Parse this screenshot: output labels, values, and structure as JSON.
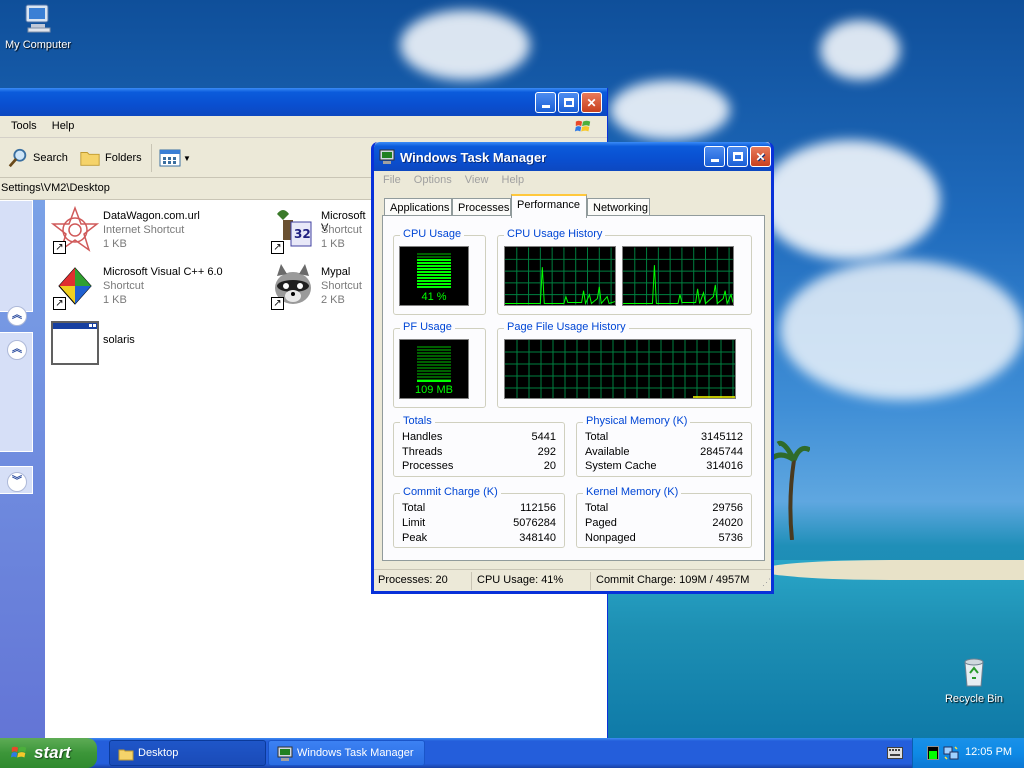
{
  "desktop": {
    "icons": [
      {
        "label": "My Computer",
        "icon": "my-computer-icon"
      },
      {
        "label": "Recycle Bin",
        "icon": "recycle-bin-icon"
      }
    ]
  },
  "explorer": {
    "menu": [
      "Tools",
      "Help"
    ],
    "toolbar": {
      "search": "Search",
      "folders": "Folders"
    },
    "address": "Settings\\VM2\\Desktop",
    "files": [
      {
        "name": "DataWagon.com.url",
        "type": "Internet Shortcut",
        "size": "1 KB",
        "icon": "datawagon-icon",
        "shortcut": true
      },
      {
        "name": "Microsoft V",
        "type": "Shortcut",
        "size": "1 KB",
        "icon": "microsoft-vm-icon",
        "shortcut": true
      },
      {
        "name": "Microsoft Visual C++ 6.0",
        "type": "Shortcut",
        "size": "1 KB",
        "icon": "visual-cpp-icon",
        "shortcut": true
      },
      {
        "name": "Mypal",
        "type": "Shortcut",
        "size": "2 KB",
        "icon": "mypal-raccoon-icon",
        "shortcut": true
      },
      {
        "name": "solaris",
        "type": "",
        "size": "",
        "icon": "window-icon",
        "shortcut": false
      }
    ]
  },
  "taskmanager": {
    "title": "Windows Task Manager",
    "menu": [
      "File",
      "Options",
      "View",
      "Help"
    ],
    "tabs": [
      "Applications",
      "Processes",
      "Performance",
      "Networking"
    ],
    "active_tab": "Performance",
    "cpu_usage": {
      "label": "CPU Usage",
      "value": "41 %"
    },
    "cpu_history": {
      "label": "CPU Usage History"
    },
    "pf_usage": {
      "label": "PF Usage",
      "value": "109 MB"
    },
    "pf_history": {
      "label": "Page File Usage History"
    },
    "totals": {
      "label": "Totals",
      "rows": [
        {
          "k": "Handles",
          "v": "5441"
        },
        {
          "k": "Threads",
          "v": "292"
        },
        {
          "k": "Processes",
          "v": "20"
        }
      ]
    },
    "physical": {
      "label": "Physical Memory (K)",
      "rows": [
        {
          "k": "Total",
          "v": "3145112"
        },
        {
          "k": "Available",
          "v": "2845744"
        },
        {
          "k": "System Cache",
          "v": "314016"
        }
      ]
    },
    "commit": {
      "label": "Commit Charge (K)",
      "rows": [
        {
          "k": "Total",
          "v": "112156"
        },
        {
          "k": "Limit",
          "v": "5076284"
        },
        {
          "k": "Peak",
          "v": "348140"
        }
      ]
    },
    "kernel": {
      "label": "Kernel Memory (K)",
      "rows": [
        {
          "k": "Total",
          "v": "29756"
        },
        {
          "k": "Paged",
          "v": "24020"
        },
        {
          "k": "Nonpaged",
          "v": "5736"
        }
      ]
    },
    "status": {
      "processes": "Processes: 20",
      "cpu": "CPU Usage: 41%",
      "commit": "Commit Charge: 109M / 4957M"
    }
  },
  "taskbar": {
    "start": "start",
    "tasks": [
      {
        "label": "Desktop",
        "icon": "folder-icon"
      },
      {
        "label": "Windows Task Manager",
        "icon": "task-manager-icon"
      }
    ],
    "clock": "12:05 PM"
  },
  "colors": {
    "xp_blue": "#0a4fd0",
    "graph_green": "#00ff00",
    "grid_green": "#008040",
    "start_green": "#3c9639"
  }
}
